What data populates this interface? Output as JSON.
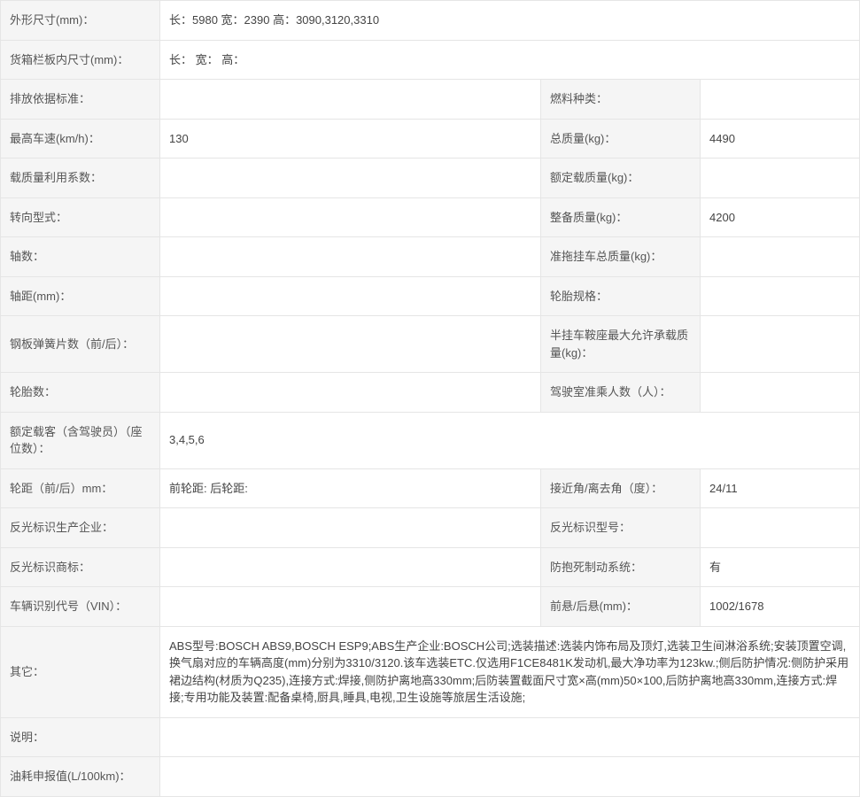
{
  "rows": {
    "dim_label": "外形尺寸(mm)：",
    "dim_value": "长：5980 宽：2390 高：3090,3120,3310",
    "cargo_label": "货箱栏板内尺寸(mm)：",
    "cargo_value": "长： 宽： 高：",
    "emission_label": "排放依据标准：",
    "emission_value": "",
    "fuel_label": "燃料种类：",
    "fuel_value": "",
    "maxspeed_label": "最高车速(km/h)：",
    "maxspeed_value": "130",
    "gross_label": "总质量(kg)：",
    "gross_value": "4490",
    "loadcoef_label": "载质量利用系数：",
    "loadcoef_value": "",
    "rated_label": "额定载质量(kg)：",
    "rated_value": "",
    "steer_label": "转向型式：",
    "steer_value": "",
    "curb_label": "整备质量(kg)：",
    "curb_value": "4200",
    "axles_label": "轴数：",
    "axles_value": "",
    "trailer_label": "准拖挂车总质量(kg)：",
    "trailer_value": "",
    "wheelbase_label": "轴距(mm)：",
    "wheelbase_value": "",
    "tirespec_label": "轮胎规格：",
    "tirespec_value": "",
    "leaf_label": "钢板弹簧片数（前/后）：",
    "leaf_value": "",
    "saddle_label": "半挂车鞍座最大允许承载质量(kg)：",
    "saddle_value": "",
    "tirenum_label": "轮胎数：",
    "tirenum_value": "",
    "cabseats_label": "驾驶室准乘人数（人）：",
    "cabseats_value": "",
    "passengers_label": "额定载客（含驾驶员）（座位数）：",
    "passengers_value": "3,4,5,6",
    "track_label": "轮距（前/后）mm：",
    "track_value": "前轮距: 后轮距:",
    "angle_label": "接近角/离去角（度）：",
    "angle_value": "24/11",
    "reflmaker_label": "反光标识生产企业：",
    "reflmaker_value": "",
    "reflmodel_label": "反光标识型号：",
    "reflmodel_value": "",
    "reflbrand_label": "反光标识商标：",
    "reflbrand_value": "",
    "abs_label": "防抱死制动系统：",
    "abs_value": "有",
    "vin_label": "车辆识别代号（VIN）：",
    "vin_value": "",
    "overhang_label": "前悬/后悬(mm)：",
    "overhang_value": "1002/1678",
    "other_label": "其它：",
    "other_value": "ABS型号:BOSCH ABS9,BOSCH ESP9;ABS生产企业:BOSCH公司;选装描述:选装内饰布局及顶灯,选装卫生间淋浴系统;安装顶置空调,换气扇对应的车辆高度(mm)分别为3310/3120.该车选装ETC.仅选用F1CE8481K发动机,最大净功率为123kw.;侧后防护情况:侧防护采用裙边结构(材质为Q235),连接方式:焊接,侧防护离地高330mm;后防装置截面尺寸宽×高(mm)50×100,后防护离地高330mm,连接方式:焊接;专用功能及装置:配备桌椅,厨具,睡具,电视,卫生设施等旅居生活设施;",
    "note_label": "说明：",
    "note_value": "",
    "fuelcons_label": "油耗申报值(L/100km)：",
    "fuelcons_value": ""
  }
}
